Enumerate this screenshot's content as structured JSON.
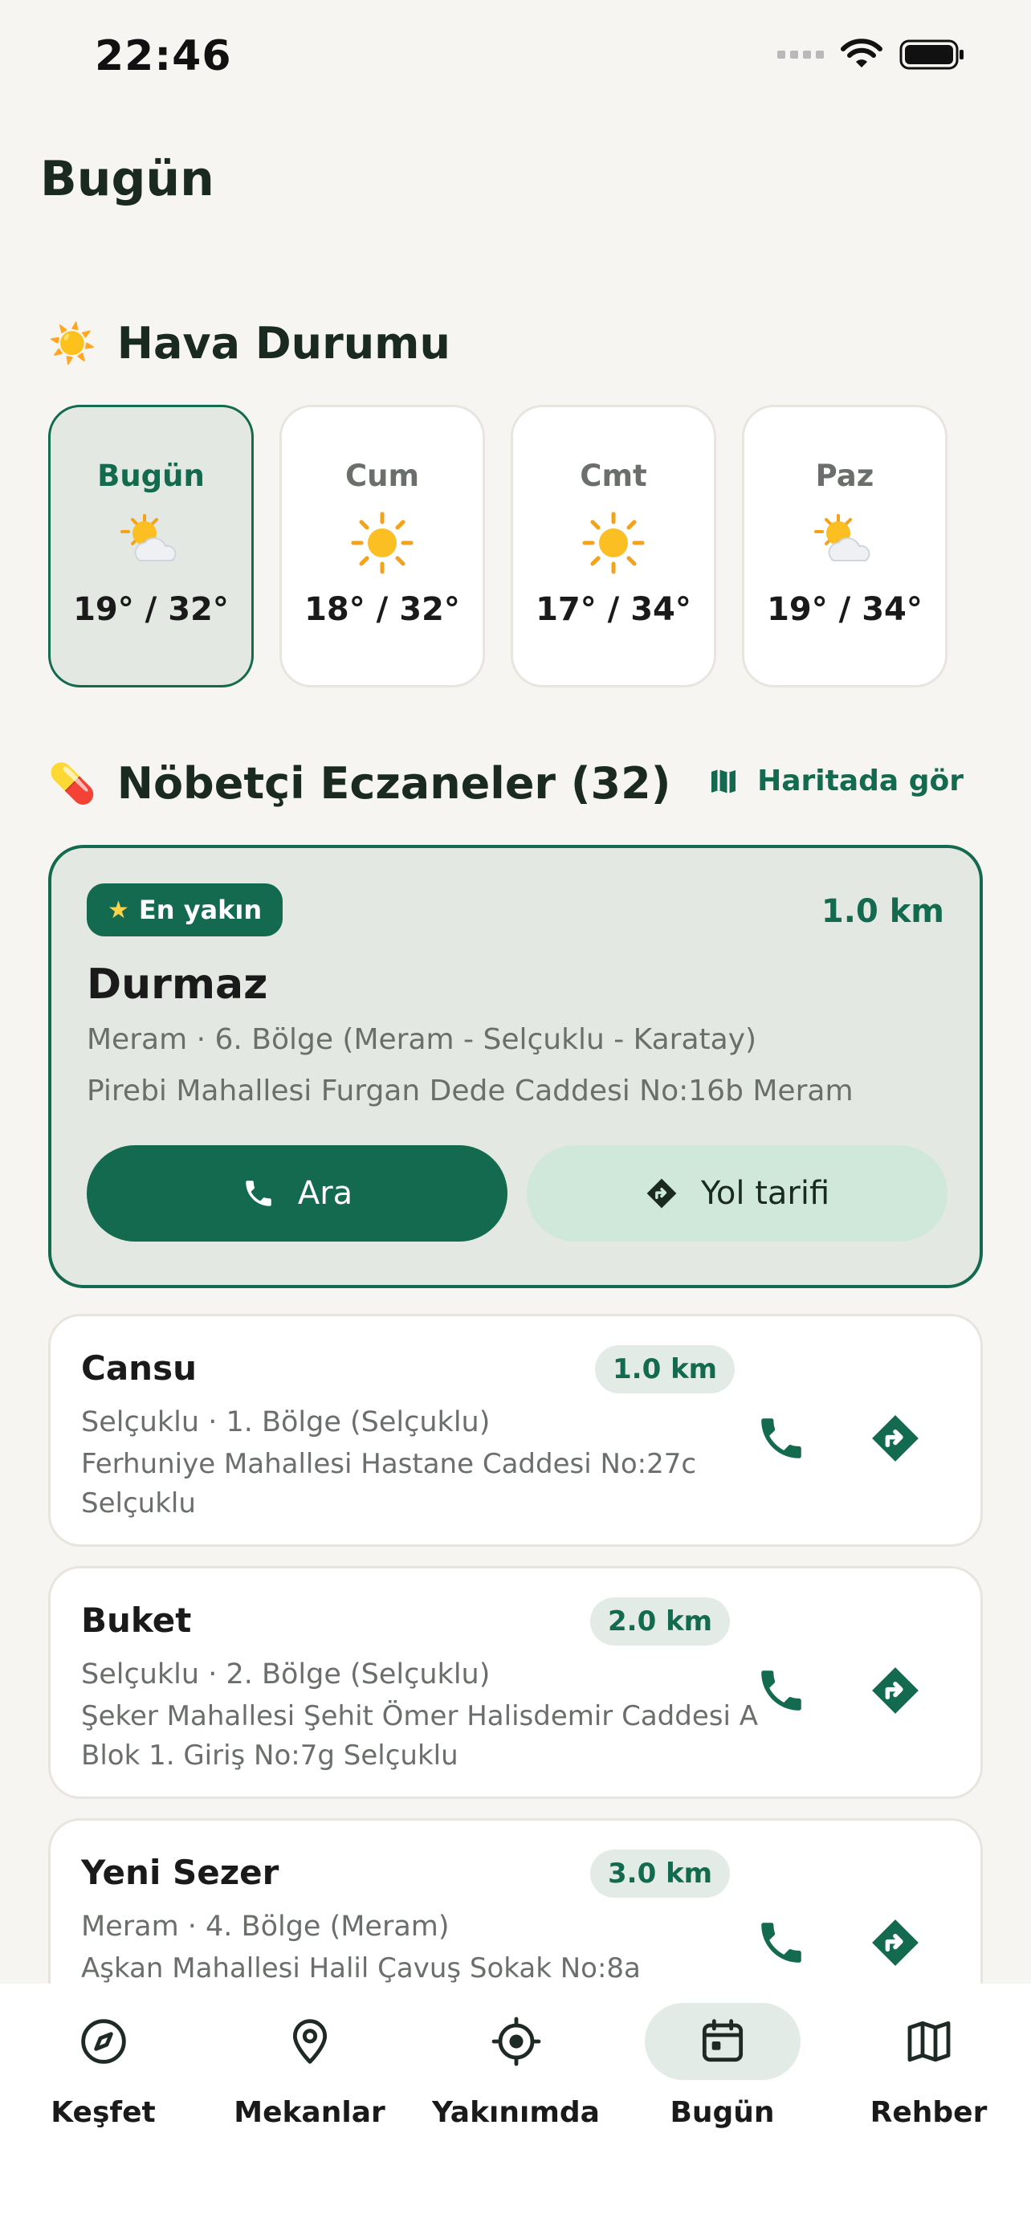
{
  "status": {
    "time": "22:46"
  },
  "page": {
    "title": "Bugün"
  },
  "weather": {
    "emoji": "☀️",
    "title": "Hava Durumu",
    "days": [
      {
        "name": "Bugün",
        "icon": "partly-sunny-icon",
        "temp": "19° / 32°"
      },
      {
        "name": "Cum",
        "icon": "sun-icon",
        "temp": "18° / 32°"
      },
      {
        "name": "Cmt",
        "icon": "sun-icon",
        "temp": "17° / 34°"
      },
      {
        "name": "Paz",
        "icon": "partly-sunny-icon",
        "temp": "19° / 34°"
      }
    ]
  },
  "pharmacies": {
    "emoji": "💊",
    "title": "Nöbetçi Eczaneler (32)",
    "map_link": "Haritada gör",
    "featured": {
      "badge": "En yakın",
      "distance": "1.0 km",
      "name": "Durmaz",
      "area": "Meram · 6. Bölge (Meram - Selçuklu - Karatay)",
      "address": "Pirebi Mahallesi Furgan Dede Caddesi No:16b Meram",
      "call_label": "Ara",
      "directions_label": "Yol tarifi"
    },
    "list": [
      {
        "name": "Cansu",
        "distance": "1.0 km",
        "area": "Selçuklu · 1. Bölge (Selçuklu)",
        "address": "Ferhuniye Mahallesi Hastane Caddesi No:27c Selçuklu"
      },
      {
        "name": "Buket",
        "distance": "2.0 km",
        "area": "Selçuklu · 2. Bölge (Selçuklu)",
        "address": "Şeker Mahallesi Şehit Ömer Halisdemir Caddesi A Blok 1. Giriş No:7g Selçuklu"
      },
      {
        "name": "Yeni Sezer",
        "distance": "3.0 km",
        "area": "Meram · 4. Bölge (Meram)",
        "address": "Aşkan Mahallesi Halil Çavuş Sokak No:8a"
      }
    ]
  },
  "tabs": [
    {
      "label": "Keşfet",
      "icon": "compass-icon"
    },
    {
      "label": "Mekanlar",
      "icon": "location-pin-icon"
    },
    {
      "label": "Yakınımda",
      "icon": "crosshair-icon"
    },
    {
      "label": "Bugün",
      "icon": "calendar-icon",
      "active": true
    },
    {
      "label": "Rehber",
      "icon": "map-icon"
    }
  ],
  "colors": {
    "accent": "#136a4e",
    "background": "#f7f5f1",
    "accent_light": "#e3e8e3"
  }
}
